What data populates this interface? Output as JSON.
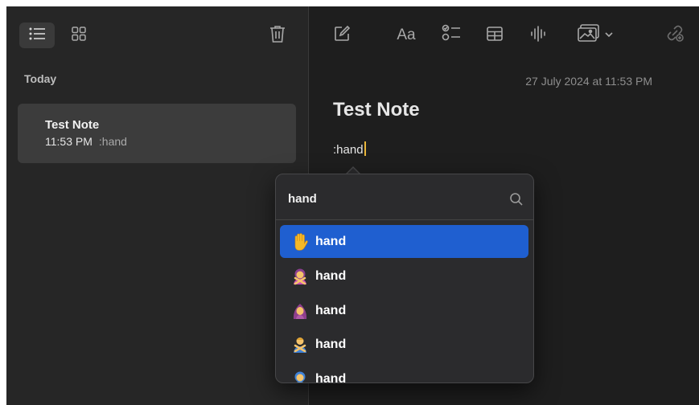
{
  "sidebar": {
    "section_heading": "Today",
    "notes": [
      {
        "title": "Test Note",
        "time": "11:53 PM",
        "preview": ":hand"
      }
    ]
  },
  "toolbar": {
    "format_label": "Aa",
    "icons": [
      "list-view-icon",
      "gallery-view-icon",
      "trash-icon",
      "compose-icon",
      "checklist-icon",
      "table-icon",
      "audio-icon",
      "media-icon",
      "chevron-down-icon",
      "link-icon"
    ]
  },
  "editor": {
    "timestamp": "27 July 2024 at 11:53 PM",
    "title": "Test Note",
    "body": ":hand"
  },
  "emoji_picker": {
    "query": "hand",
    "results": [
      {
        "emoji": "raised-hand",
        "label": "hand",
        "selected": true
      },
      {
        "emoji": "person-gesturing-no",
        "label": "hand",
        "selected": false
      },
      {
        "emoji": "woman-with-headscarf",
        "label": "hand",
        "selected": false
      },
      {
        "emoji": "person-crossed-arms",
        "label": "hand",
        "selected": false
      },
      {
        "emoji": "person-partial",
        "label": "hand",
        "selected": false
      }
    ]
  },
  "colors": {
    "selection": "#1f5fd0",
    "caret": "#e8b53a"
  }
}
